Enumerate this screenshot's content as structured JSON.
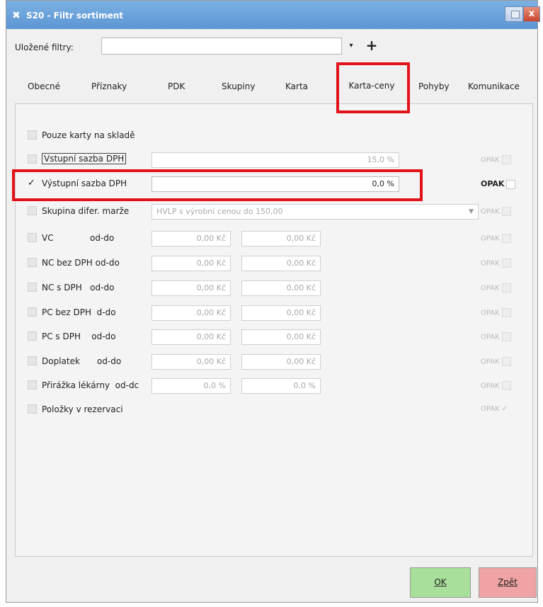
{
  "window": {
    "title": "S20 - Filtr sortiment",
    "app_icon": "x-logo-icon",
    "close_label": "x"
  },
  "saved_filters": {
    "label": "Uložené filtry:",
    "value": "",
    "dropdown_icon": "▾",
    "add_label": "+"
  },
  "tabs": [
    {
      "label": "Obecné"
    },
    {
      "label": "Příznaky"
    },
    {
      "label": "PDK"
    },
    {
      "label": "Skupiny"
    },
    {
      "label": "Karta"
    },
    {
      "label": "Karta-ceny",
      "active": true
    },
    {
      "label": "Pohyby"
    },
    {
      "label": "Komunikace"
    }
  ],
  "rows": {
    "pouze_karty": {
      "label": "Pouze karty na skladě",
      "checked": false
    },
    "vstupni_sazba": {
      "label": "Vstupní sazba DPH",
      "value": "15,0 %",
      "opak": "OPAK",
      "checked": false
    },
    "vystupni_sazba": {
      "label": "Výstupní sazba DPH",
      "value": "0,0 %",
      "opak": "OPAK",
      "checked": true,
      "check_glyph": "✓"
    },
    "skupina_marze": {
      "label": "Skupina difer. marže",
      "value": "HVLP s výrobní cenou do 150,00",
      "opak": "OPAK",
      "checked": false
    },
    "vc": {
      "label": "VC",
      "sub": "od-do",
      "from": "0,00 Kč",
      "to": "0,00 Kč",
      "opak": "OPAK"
    },
    "nc_bez": {
      "label": "NC bez DPH od-do",
      "from": "0,00 Kč",
      "to": "0,00 Kč",
      "opak": "OPAK"
    },
    "nc_s": {
      "label": "NC s DPH   od-do",
      "from": "0,00 Kč",
      "to": "0,00 Kč",
      "opak": "OPAK"
    },
    "pc_bez": {
      "label": "PC bez DPH  d-do",
      "from": "0,00 Kč",
      "to": "0,00 Kč",
      "opak": "OPAK"
    },
    "pc_s": {
      "label": "PC s DPH    od-do",
      "from": "0,00 Kč",
      "to": "0,00 Kč",
      "opak": "OPAK"
    },
    "doplatek": {
      "label": "Doplatek",
      "sub": "od-do",
      "from": "0,00 Kč",
      "to": "0,00 Kč",
      "opak": "OPAK"
    },
    "prirazka": {
      "label": "Přirážka lékárny  od-dc",
      "from": "0,0 %",
      "to": "0,0 %",
      "opak": "OPAK"
    },
    "polozky": {
      "label": "Položky v rezervaci",
      "opak": "OPAK",
      "opak_check": "✓"
    }
  },
  "buttons": {
    "ok": "OK",
    "back": "Zpět"
  },
  "colors": {
    "titlebar": "#6aa3dc",
    "highlight": "#e2121a",
    "ok_bg": "#a8df9a",
    "back_bg": "#f0a3a5"
  }
}
